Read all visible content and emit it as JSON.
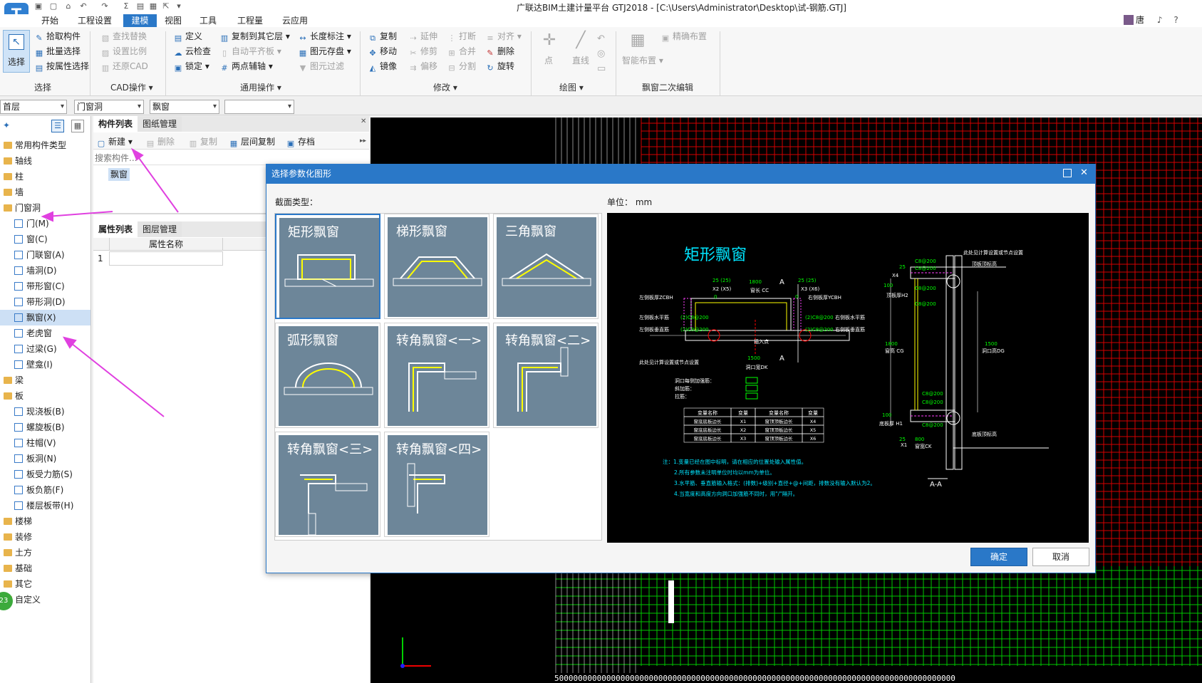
{
  "app": {
    "icon_letter": "T",
    "title": "广联达BIM土建计量平台 GTJ2018 - [C:\\Users\\Administrator\\Desktop\\试-钢筋.GTJ]",
    "user": "唐"
  },
  "menu_tabs": [
    "开始",
    "工程设置",
    "建模",
    "视图",
    "工具",
    "工程量",
    "云应用"
  ],
  "menu_active": "建模",
  "ribbon": {
    "select_label": "选择",
    "groups": {
      "select": "选择",
      "cad": "CAD操作",
      "common": "通用操作",
      "modify": "修改",
      "draw": "绘图",
      "bay": "飘窗二次编辑"
    },
    "select_items": [
      "拾取构件",
      "批量选择",
      "按属性选择"
    ],
    "cad_items": [
      "查找替换",
      "设置比例",
      "还原CAD"
    ],
    "common_col1": [
      "定义",
      "云检查",
      "锁定"
    ],
    "common_col2": [
      "复制到其它层",
      "自动平齐板",
      "两点辅轴"
    ],
    "common_col3": [
      "长度标注",
      "图元存盘",
      "图元过滤"
    ],
    "modify_col1": [
      "复制",
      "移动",
      "镜像"
    ],
    "modify_col2": [
      "延伸",
      "修剪",
      "偏移"
    ],
    "modify_col3": [
      "打断",
      "合并",
      "分割"
    ],
    "modify_col4": [
      "对齐",
      "删除",
      "旋转"
    ],
    "draw_items": [
      "点",
      "直线"
    ],
    "bay_items": [
      "智能布置",
      "精确布置"
    ]
  },
  "combos": [
    "首层",
    "门窗洞",
    "飘窗",
    ""
  ],
  "tree": [
    {
      "label": "常用构件类型",
      "type": "folder"
    },
    {
      "label": "轴线",
      "type": "folder"
    },
    {
      "label": "柱",
      "type": "folder"
    },
    {
      "label": "墙",
      "type": "folder"
    },
    {
      "label": "门窗洞",
      "type": "folder-open"
    },
    {
      "label": "门(M)",
      "type": "item"
    },
    {
      "label": "窗(C)",
      "type": "item"
    },
    {
      "label": "门联窗(A)",
      "type": "item"
    },
    {
      "label": "墙洞(D)",
      "type": "item"
    },
    {
      "label": "带形窗(C)",
      "type": "item"
    },
    {
      "label": "带形洞(D)",
      "type": "item"
    },
    {
      "label": "飘窗(X)",
      "type": "item",
      "selected": true
    },
    {
      "label": "老虎窗",
      "type": "item"
    },
    {
      "label": "过梁(G)",
      "type": "item"
    },
    {
      "label": "壁龛(I)",
      "type": "item"
    },
    {
      "label": "梁",
      "type": "folder"
    },
    {
      "label": "板",
      "type": "folder-open"
    },
    {
      "label": "现浇板(B)",
      "type": "item"
    },
    {
      "label": "螺旋板(B)",
      "type": "item"
    },
    {
      "label": "柱帽(V)",
      "type": "item"
    },
    {
      "label": "板洞(N)",
      "type": "item"
    },
    {
      "label": "板受力筋(S)",
      "type": "item"
    },
    {
      "label": "板负筋(F)",
      "type": "item"
    },
    {
      "label": "楼层板带(H)",
      "type": "item"
    },
    {
      "label": "楼梯",
      "type": "folder"
    },
    {
      "label": "装修",
      "type": "folder"
    },
    {
      "label": "土方",
      "type": "folder"
    },
    {
      "label": "基础",
      "type": "folder"
    },
    {
      "label": "其它",
      "type": "folder"
    },
    {
      "label": "自定义",
      "type": "folder"
    }
  ],
  "tree_badge": "23",
  "components": {
    "tabs": [
      "构件列表",
      "图纸管理"
    ],
    "toolbar": [
      "新建",
      "删除",
      "复制",
      "层间复制",
      "存档"
    ],
    "search_placeholder": "搜索构件...",
    "item": "飘窗"
  },
  "properties": {
    "tabs": [
      "属性列表",
      "图层管理"
    ],
    "column": "属性名称",
    "row_number": "1"
  },
  "dialog": {
    "title": "选择参数化图形",
    "section_label": "截面类型：",
    "unit_label": "单位：",
    "unit_value": "mm",
    "shapes": [
      "矩形飘窗",
      "梯形飘窗",
      "三角飘窗",
      "弧形飘窗",
      "转角飘窗<一>",
      "转角飘窗<二>",
      "转角飘窗<三>",
      "转角飘窗<四>"
    ],
    "selected_shape": "矩形飘窗",
    "ok": "确定",
    "cancel": "取消",
    "preview": {
      "title": "矩形飘窗",
      "labels": {
        "dim_1800": "1800",
        "win_len": "窗长 CC",
        "x5": "X2 (X5)",
        "x6": "X3 (X6)",
        "left_depth": "左侧板厚ZCBH",
        "right_depth": "右侧板厚YCBH",
        "left_h": "左侧板水平筋",
        "left_v": "左侧板垂直筋",
        "right_h": "右侧板水平筋",
        "right_v": "右侧板垂直筋",
        "rebar1": "(2)C8@200",
        "rebar2": "(2)C8@200",
        "rebar3": "(2)C8@200",
        "rebar4": "(2)C8@200",
        "insert": "插入点",
        "d1500": "1500",
        "opening_w": "洞口宽DK",
        "note_set": "此处见计算设置或节点设置",
        "note_set2": "此处见计算设置或节点设置",
        "top_elev": "顶板顶标高",
        "bot_elev": "底板顶标高",
        "top_thk": "顶板厚H2",
        "bot_thk": "底板厚 H1",
        "win_h": "窗高 CG",
        "open_h": "洞口高DG",
        "d1500b": "1500",
        "d1800": "1800",
        "d25a": "25",
        "d25b": "25",
        "d100a": "100",
        "d100b": "100",
        "x4": "X4",
        "x1": "X1",
        "d800": "800",
        "win_depth": "窗宽CK",
        "c1": "C8@200",
        "c2": "C8@200",
        "c3": "C8@200",
        "c4": "C8@200",
        "c5": "C8@200",
        "c6": "C8@200",
        "c7": "C8@200",
        "aa": "A-A",
        "sec_a1": "A",
        "sec_a2": "A",
        "dim_25a": "25 (25)",
        "dim_25b": "25 (25)",
        "dim_0a": "0",
        "dim_0b": "0"
      },
      "legend": [
        "洞口每侧加强筋：",
        "斜加筋：",
        "拉筋："
      ],
      "table_headers": [
        "变量名称",
        "变量",
        "变量名称",
        "变量"
      ],
      "table_rows": [
        [
          "窗底底板边长",
          "X1",
          "窗顶顶板边长",
          "X4"
        ],
        [
          "窗底底板边长",
          "X2",
          "窗顶顶板边长",
          "X5"
        ],
        [
          "窗底底板边长",
          "X3",
          "窗顶顶板边长",
          "X6"
        ]
      ],
      "notes": [
        "注：1.变量已经在图中标明，请在相应的位置处输入属性值。",
        "2.所有参数未注明单位时均以mm为单位。",
        "3.水平筋、垂直筋输入格式：(排数)+级别+直径+@+间距，排数没有输入默认为2。",
        "4.当宽度和高度方向洞口加强筋不同时，用\"/\"隔开。"
      ]
    }
  },
  "canvas": {
    "axis_labels_bottom": "5000000000000000000000000000000000000000000000000000000000000000000000000000000000000",
    "grid_color": "#d40000",
    "grid2_color": "#00c800"
  },
  "colors": {
    "accent": "#2a78c8",
    "annotation_arrow": "#e040e0"
  }
}
